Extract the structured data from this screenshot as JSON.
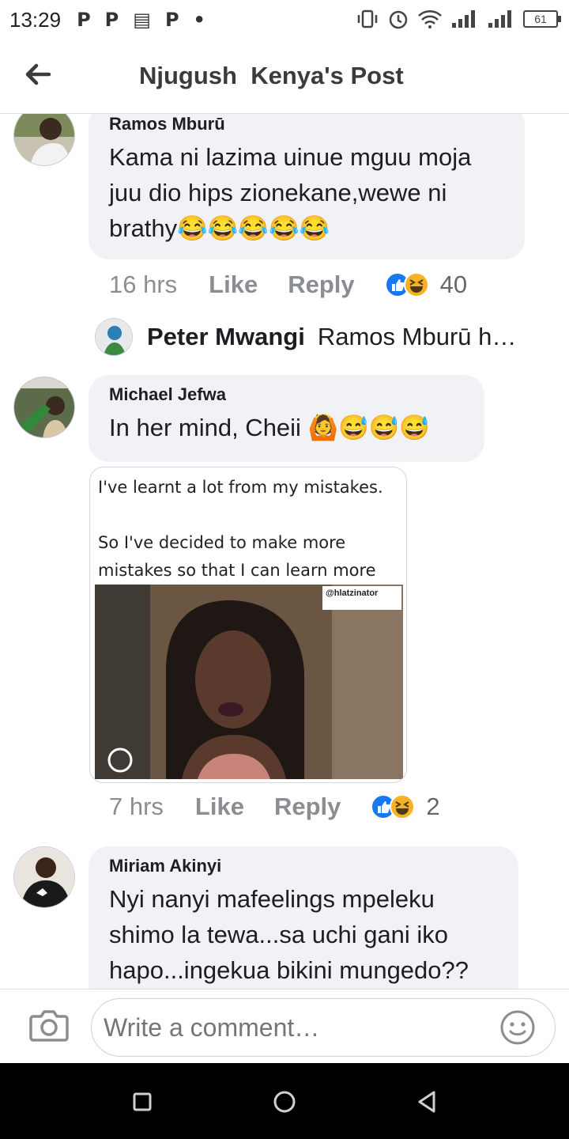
{
  "status_bar": {
    "time": "13:29",
    "notifications": [
      "P",
      "P",
      "▤",
      "P",
      "•"
    ],
    "battery": "61"
  },
  "header": {
    "title": "Njugush  Kenya's Post"
  },
  "comments": [
    {
      "author": "Ramos Mburū",
      "lines": [
        "Kama ni lazima uinue mguu moja",
        "juu dio hips zionekane,wewe ni",
        "brathy😂😂😂😂😂"
      ],
      "time": "16 hrs",
      "like": "Like",
      "reply": "Reply",
      "reaction_count": "40"
    },
    {
      "author": "Michael Jefwa",
      "lines": [
        "In her mind, Cheii 🙆😅😅😅"
      ],
      "time": "7 hrs",
      "like": "Like",
      "reply": "Reply",
      "reaction_count": "2"
    },
    {
      "author": "Miriam Akinyi",
      "lines": [
        "Nyi nanyi mafeelings mpeleku",
        "shimo la tewa...sa uchi gani iko",
        "hapo...ingekua bikini mungedo??"
      ]
    }
  ],
  "reply_preview": {
    "author": "Peter Mwangi",
    "snippet": "Ramos Mburū h…"
  },
  "meme": {
    "caption": "I've learnt a lot from my mistakes.\n\nSo I've decided to make more\nmistakes so that I can learn more",
    "watermark": "@hlatzinator"
  },
  "composer": {
    "placeholder": "Write a comment…"
  },
  "colors": {
    "like_blue": "#1877f2",
    "haha_yellow": "#f7b125",
    "bubble_bg": "#f0f2f5",
    "meta_gray": "#8a8d91"
  },
  "icons": [
    "back-arrow-icon",
    "camera-icon",
    "emoji-icon",
    "like-reaction-icon",
    "haha-reaction-icon",
    "nav-back-icon",
    "nav-home-icon",
    "nav-recents-icon"
  ]
}
